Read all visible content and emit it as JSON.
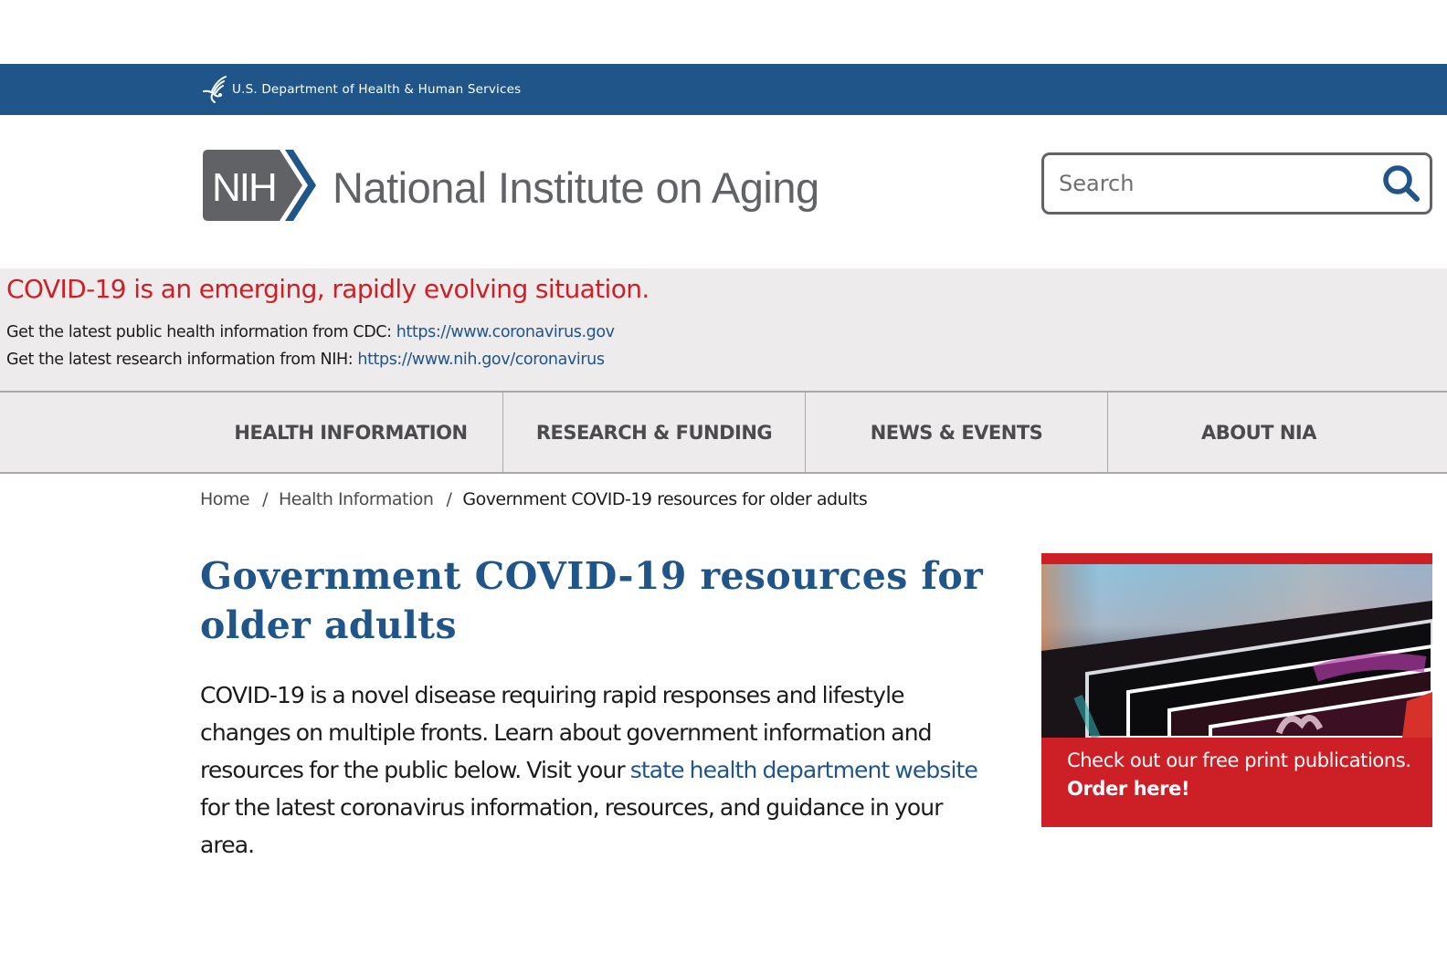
{
  "hhs_bar": {
    "icon": "hhs-eagle-icon",
    "label": "U.S. Department of Health & Human Services"
  },
  "header": {
    "logo_badge": "NIH",
    "logo_name": "National Institute on Aging",
    "search": {
      "placeholder": "Search",
      "value": "",
      "icon": "search-icon"
    }
  },
  "alert": {
    "title": "COVID-19 is an emerging, rapidly evolving situation.",
    "lines": [
      {
        "text": "Get the latest public health information from CDC: ",
        "link": "https://www.coronavirus.gov"
      },
      {
        "text": "Get the latest research information from NIH: ",
        "link": "https://www.nih.gov/coronavirus"
      }
    ]
  },
  "nav": {
    "items": [
      {
        "label": "HEALTH INFORMATION"
      },
      {
        "label": "RESEARCH & FUNDING"
      },
      {
        "label": "NEWS & EVENTS"
      },
      {
        "label": "ABOUT NIA"
      }
    ]
  },
  "breadcrumb": {
    "items": [
      "Home",
      "Health Information"
    ],
    "separator": "/",
    "current": "Government COVID-19 resources for older adults"
  },
  "main": {
    "title": "Government COVID-19 resources for older adults",
    "intro_before": "COVID-19 is a novel disease requiring rapid responses and lifestyle changes on multiple fronts. Learn about government information and resources for the public below. Visit your ",
    "intro_link": "state health department website",
    "intro_after": " for the latest coronavirus information, resources, and guidance in your area."
  },
  "promo": {
    "text": "Check out our free print publications.",
    "cta": "Order here!",
    "image": "publications-photo"
  },
  "colors": {
    "hhs_blue": "#20558a",
    "alert_red": "#cd2026",
    "logo_gray": "#616265",
    "band_gray": "#edebec",
    "link_blue": "#20558a"
  }
}
